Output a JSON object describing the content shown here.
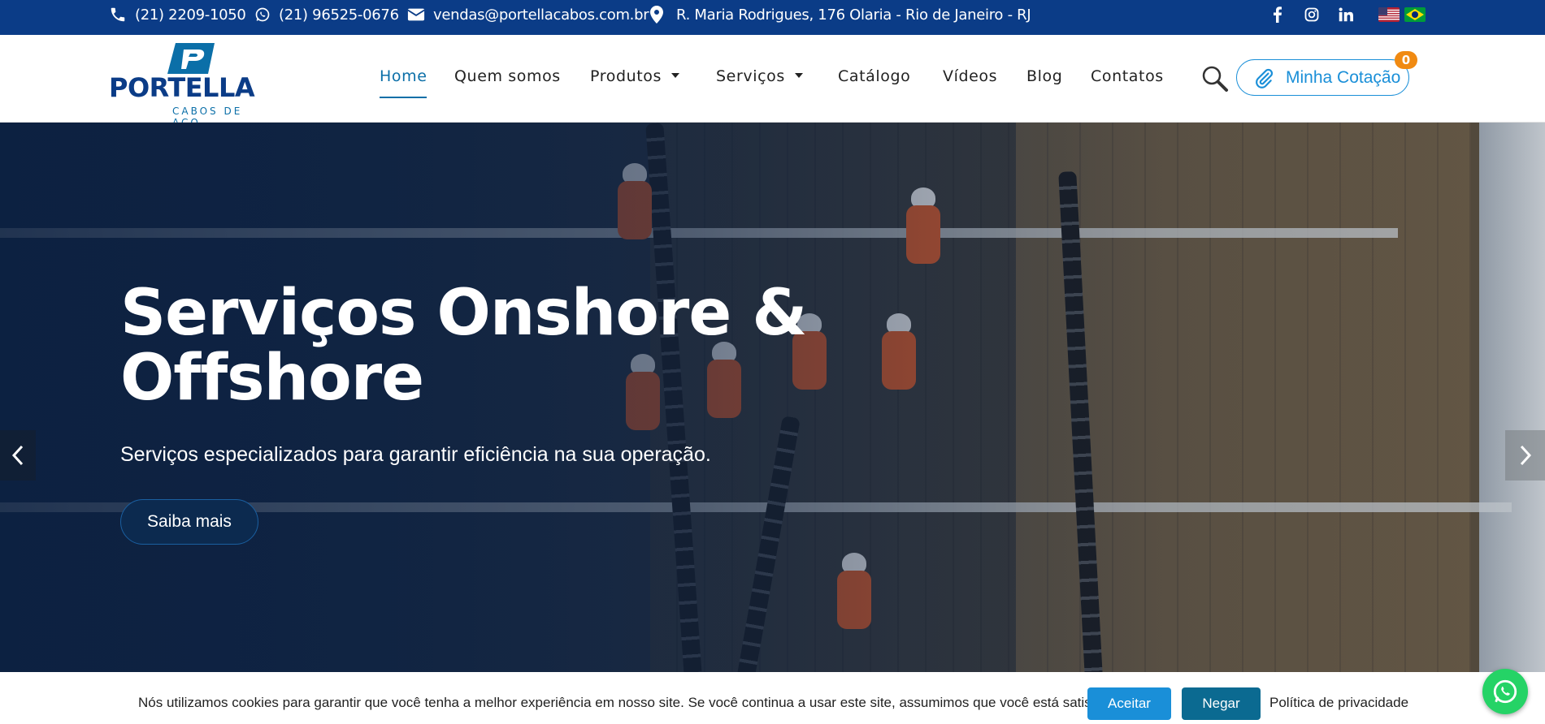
{
  "topbar": {
    "phone": "(21) 2209-1050",
    "whatsapp": "(21) 96525-0676",
    "email": "vendas@portellacabos.com.br",
    "address": "R. Maria Rodrigues, 176 Olaria - Rio de Janeiro - RJ"
  },
  "logo": {
    "name": "PORTELLA",
    "tagline": "CABOS DE AÇO"
  },
  "nav": {
    "home": "Home",
    "quem_somos": "Quem somos",
    "produtos": "Produtos",
    "servicos": "Serviços",
    "catalogo": "Catálogo",
    "videos": "Vídeos",
    "blog": "Blog",
    "contatos": "Contatos"
  },
  "cart": {
    "label": "Minha Cotação",
    "count": "0"
  },
  "hero": {
    "title": "Serviços Onshore & Offshore",
    "subtitle": "Serviços especializados para garantir eficiência na sua operação.",
    "button": "Saiba mais"
  },
  "cookie": {
    "message": "Nós utilizamos cookies para garantir que você tenha a melhor experiência em nosso site. Se você continua a usar este site, assumimos que você está satisfeito.",
    "accept": "Aceitar",
    "deny": "Negar",
    "policy": "Política de privacidade"
  },
  "colors": {
    "brand_blue": "#0b3c87",
    "accent": "#1a8fd8",
    "badge": "#f08a12",
    "whatsapp": "#25d366"
  },
  "icons": [
    "phone-icon",
    "whatsapp-icon",
    "mail-icon",
    "location-pin-icon",
    "facebook-icon",
    "instagram-icon",
    "linkedin-icon",
    "us-flag-icon",
    "brazil-flag-icon",
    "search-icon",
    "paperclip-icon",
    "chevron-left-icon",
    "chevron-right-icon"
  ]
}
